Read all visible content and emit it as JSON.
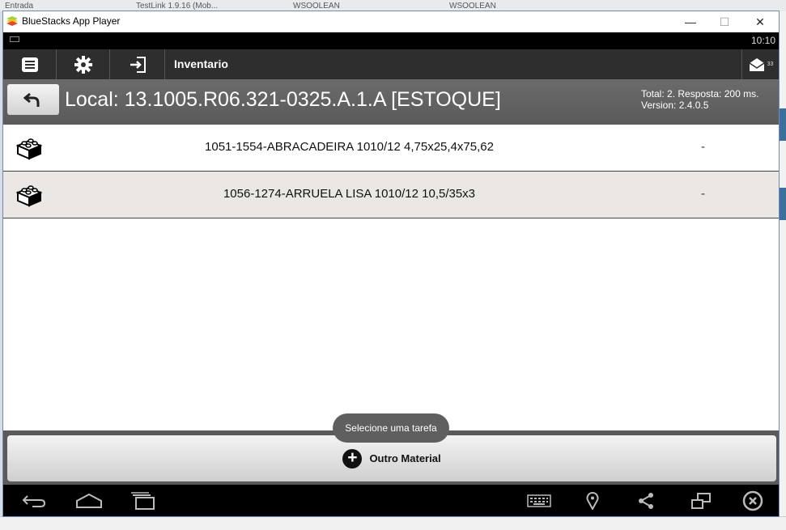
{
  "background": {
    "tabs": [
      "Entrada",
      "TestLink 1.9.16 (Mob...",
      "WSOOLEAN",
      "WSOOLEAN"
    ]
  },
  "window": {
    "title": "BlueStacks App Player",
    "minimize": "—",
    "maximize": "☐",
    "close": "✕"
  },
  "statusbar": {
    "time": "10:10"
  },
  "actionbar": {
    "title": "Inventario",
    "icons": [
      "menu-icon",
      "gear-icon",
      "login-icon",
      "mail-icon"
    ],
    "mail_count": "33"
  },
  "location": {
    "label": "Local: 13.1005.R06.321-0325.A.1.A [ESTOQUE]",
    "total_info": "Total: 2. Resposta: 200 ms.",
    "version": "Version: 2.4.0.5"
  },
  "items": [
    {
      "name": "1051-1554-ABRACADEIRA 1010/12 4,75x25,4x75,62",
      "value": "-"
    },
    {
      "name": "1056-1274-ARRUELA LISA 1010/12 10,5/35x3",
      "value": "-"
    }
  ],
  "toast": "Selecione uma tarefa",
  "bottom_button": "Outro Material",
  "navbar": {
    "icons": [
      "back-icon",
      "home-icon",
      "recents-icon",
      "keyboard-icon",
      "location-icon",
      "share-icon",
      "multi-window-icon",
      "close-circle-icon"
    ]
  },
  "colors": {
    "actionbar": "#2e2e2e",
    "location_bar": "#606060",
    "alt_row": "#ebe7e5",
    "window_border": "#6b8cb5"
  }
}
